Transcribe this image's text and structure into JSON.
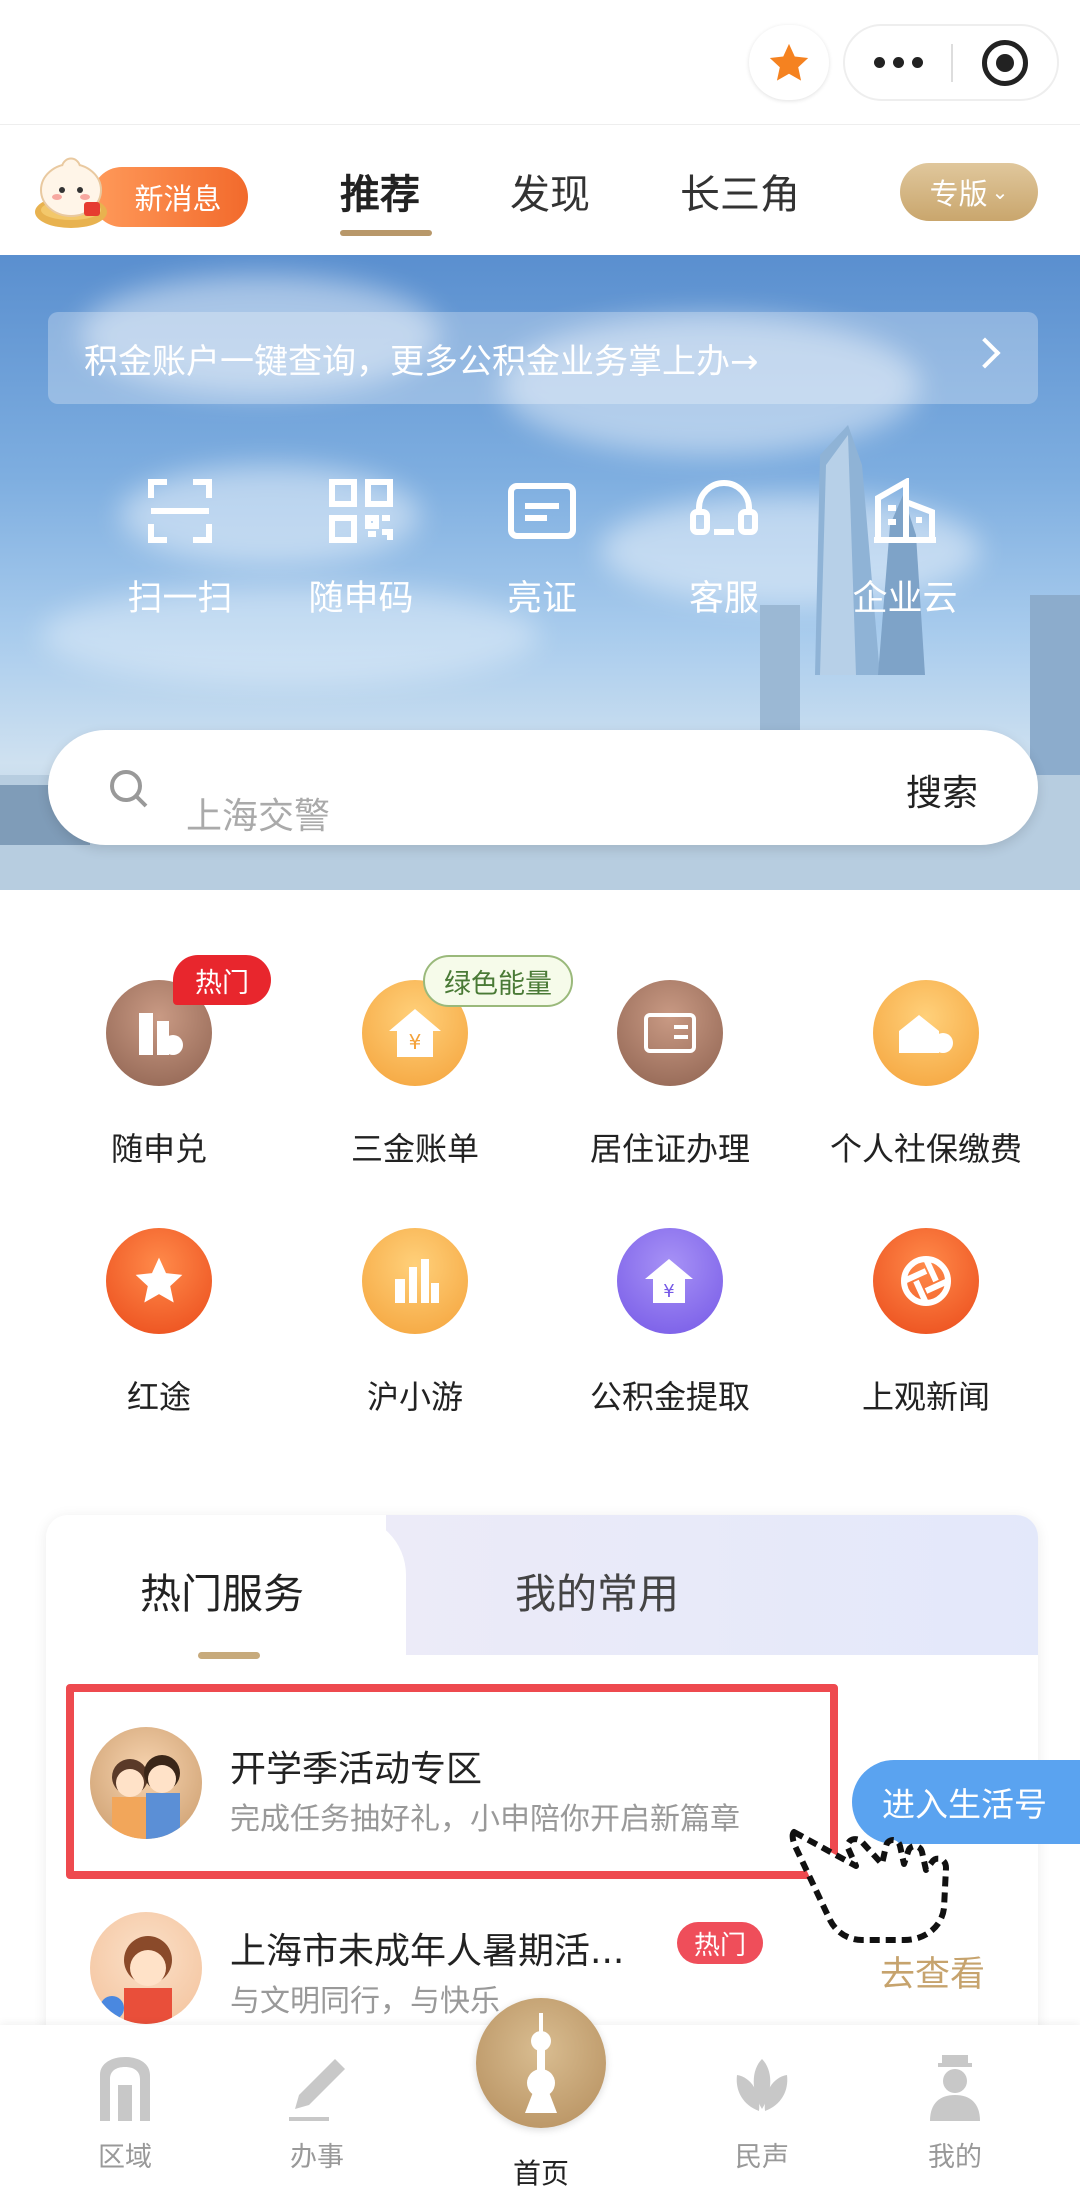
{
  "header": {
    "new_message": "新消息",
    "edition": "专版"
  },
  "tabs": [
    "推荐",
    "发现",
    "长三角"
  ],
  "banner": {
    "notice": "积金账户一键查询，更多公积金业务掌上办→",
    "quick_actions": [
      "扫一扫",
      "随申码",
      "亮证",
      "客服",
      "企业云"
    ]
  },
  "search": {
    "placeholder": "上海交警",
    "button": "搜索"
  },
  "services": [
    "随申兑",
    "三金账单",
    "居住证办理",
    "个人社保缴费",
    "红途",
    "沪小游",
    "公积金提取",
    "上观新闻"
  ],
  "badges": {
    "hot": "热门",
    "green": "绿色能量"
  },
  "card": {
    "tabs": [
      "热门服务",
      "我的常用"
    ],
    "rows": [
      {
        "title": "开学季活动专区",
        "subtitle": "完成任务抽好礼，小申陪你开启新篇章"
      },
      {
        "title": "上海市未成年人暑期活...",
        "subtitle": "与文明同行，与快乐",
        "badge": "热门",
        "action": "去查看"
      }
    ],
    "floating_button": "进入生活号"
  },
  "bottom_nav": [
    "区域",
    "办事",
    "首页",
    "民声",
    "我的"
  ],
  "colors": {
    "accent": "#b8986a",
    "hot_red": "#e8262d",
    "highlight": "#ee4a4f",
    "blue": "#5aa3f0"
  }
}
